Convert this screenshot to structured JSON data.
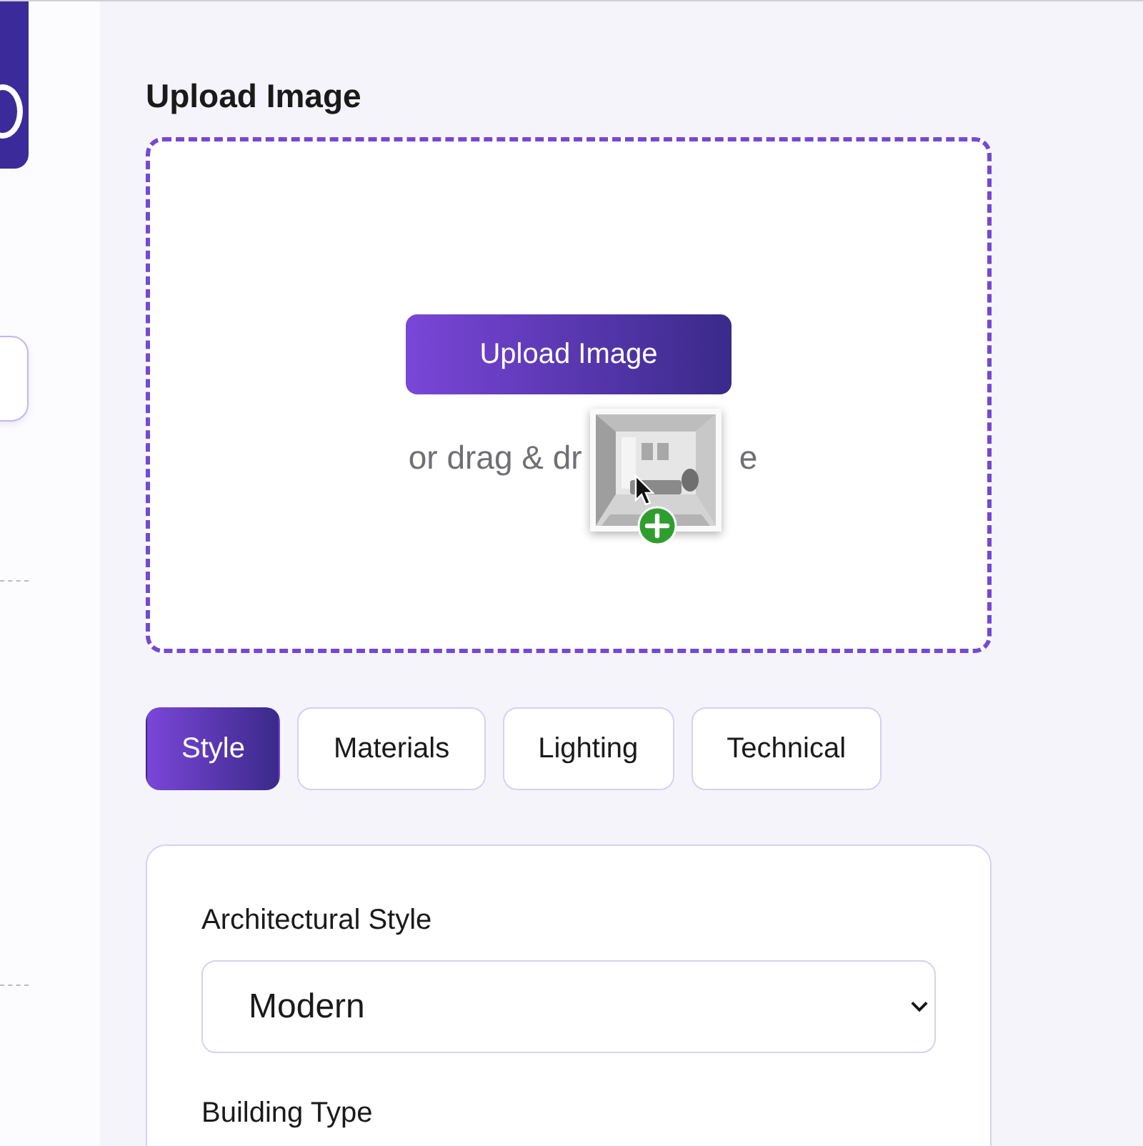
{
  "upload": {
    "heading": "Upload Image",
    "button": "Upload Image",
    "hint_before": "or drag & dr",
    "hint_after": "e"
  },
  "tabs": [
    {
      "label": "Style",
      "selected": true
    },
    {
      "label": "Materials",
      "selected": false
    },
    {
      "label": "Lighting",
      "selected": false
    },
    {
      "label": "Technical",
      "selected": false
    }
  ],
  "panel": {
    "fields": [
      {
        "label": "Architectural Style",
        "kind": "select",
        "value": "Modern"
      },
      {
        "label": "Building Type",
        "kind": "label"
      }
    ]
  }
}
